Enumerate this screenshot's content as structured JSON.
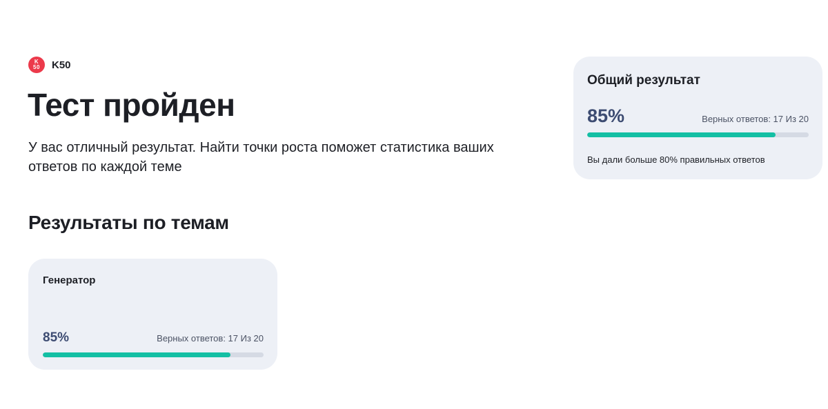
{
  "brand": {
    "logo_text": "K 50",
    "name": "K50"
  },
  "page": {
    "title": "Тест пройден",
    "subtitle": "У вас отличный результат. Найти точки роста поможет статистика ваших ответов по каждой теме",
    "section_title": "Результаты по темам"
  },
  "summary": {
    "title": "Общий результат",
    "percent_label": "85%",
    "percent_value": 85,
    "answers_text": "Верных ответов: 17 Из 20",
    "note": "Вы дали больше 80% правильных ответов"
  },
  "topics": [
    {
      "title": "Генератор",
      "percent_label": "85%",
      "percent_value": 85,
      "answers_text": "Верных ответов: 17 Из 20"
    }
  ],
  "colors": {
    "accent": "#14bfa4",
    "percent_text": "#3d4c72",
    "card_bg": "#edf0f6",
    "brand": "#ec3a4b"
  }
}
